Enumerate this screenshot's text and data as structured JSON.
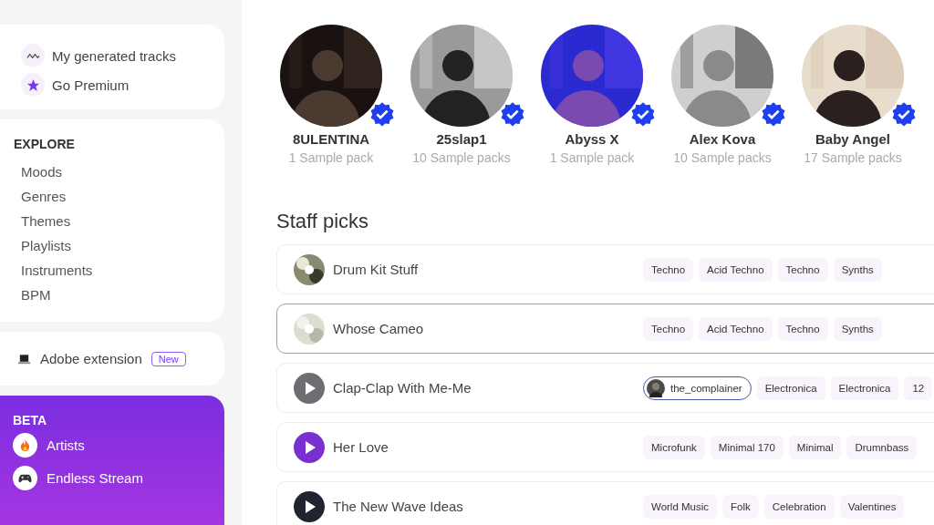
{
  "sidebar": {
    "quick_links": [
      {
        "label": "My generated tracks",
        "kind": "wave"
      },
      {
        "label": "Go Premium",
        "kind": "star"
      }
    ],
    "explore": {
      "heading": "EXPLORE",
      "items": [
        "Moods",
        "Genres",
        "Themes",
        "Playlists",
        "Instruments",
        "BPM"
      ]
    },
    "extension": {
      "label": "Adobe extension",
      "badge": "New"
    },
    "beta": {
      "heading": "BETA",
      "items": [
        {
          "label": "Artists",
          "kind": "fire"
        },
        {
          "label": "Endless Stream",
          "kind": "gamepad"
        }
      ]
    }
  },
  "artists": [
    {
      "name": "8ULENTINA",
      "packs": "1 Sample pack",
      "verified": true
    },
    {
      "name": "25slap1",
      "packs": "10 Sample packs",
      "verified": true
    },
    {
      "name": "Abyss X",
      "packs": "1 Sample pack",
      "verified": true
    },
    {
      "name": "Alex Kova",
      "packs": "10 Sample packs",
      "verified": true
    },
    {
      "name": "Baby Angel",
      "packs": "17 Sample packs",
      "verified": true
    }
  ],
  "staff_picks": {
    "title": "Staff picks",
    "rows": [
      {
        "title": "Drum Kit Stuff",
        "kind": "cover",
        "selected": false,
        "tags": [
          {
            "kind": "tag",
            "label": "Techno"
          },
          {
            "kind": "tag",
            "label": "Acid Techno"
          },
          {
            "kind": "tag",
            "label": "Techno"
          },
          {
            "kind": "tag",
            "label": "Synths"
          }
        ]
      },
      {
        "title": "Whose Cameo",
        "kind": "cover",
        "selected": true,
        "tags": [
          {
            "kind": "tag",
            "label": "Techno"
          },
          {
            "kind": "tag",
            "label": "Acid Techno"
          },
          {
            "kind": "tag",
            "label": "Techno"
          },
          {
            "kind": "tag",
            "label": "Synths"
          }
        ]
      },
      {
        "title": "Clap-Clap With Me-Me",
        "kind": "play",
        "color": "#6e6e72",
        "selected": false,
        "tags": [
          {
            "kind": "user",
            "label": "the_complainer"
          },
          {
            "kind": "tag",
            "label": "Electronica"
          },
          {
            "kind": "tag",
            "label": "Electronica"
          },
          {
            "kind": "tag",
            "label": "12"
          }
        ]
      },
      {
        "title": "Her Love",
        "kind": "play",
        "color": "#7a2fd0",
        "selected": false,
        "tags": [
          {
            "kind": "tag",
            "label": "Microfunk"
          },
          {
            "kind": "tag",
            "label": "Minimal 170"
          },
          {
            "kind": "tag",
            "label": "Minimal"
          },
          {
            "kind": "tag",
            "label": "Drumnbass"
          }
        ]
      },
      {
        "title": "The New Wave Ideas",
        "kind": "play",
        "color": "#1f2430",
        "selected": false,
        "tags": [
          {
            "kind": "tag",
            "label": "World Music"
          },
          {
            "kind": "tag",
            "label": "Folk"
          },
          {
            "kind": "tag",
            "label": "Celebration"
          },
          {
            "kind": "tag",
            "label": "Valentines"
          }
        ]
      }
    ]
  }
}
